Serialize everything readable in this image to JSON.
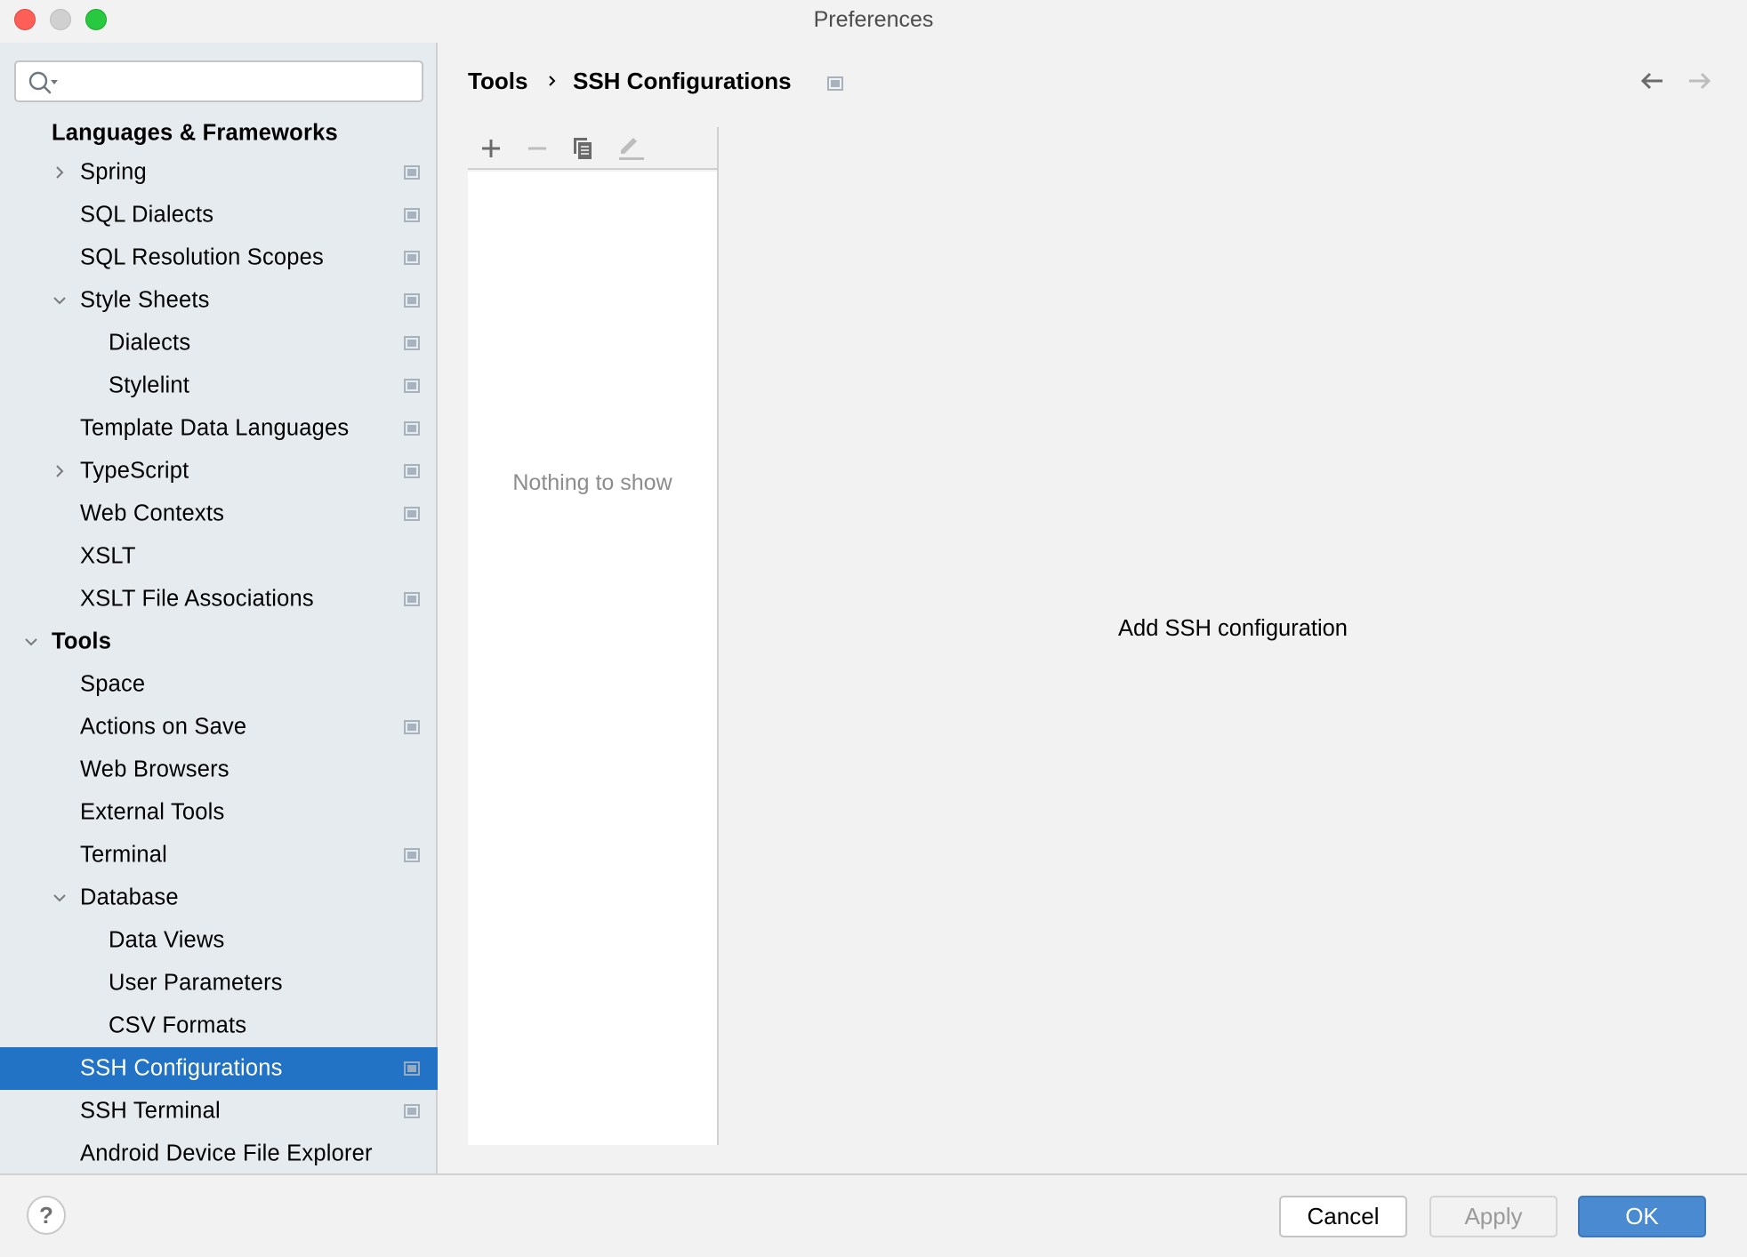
{
  "window": {
    "title": "Preferences"
  },
  "search": {
    "value": "",
    "placeholder": ""
  },
  "sidebar": {
    "items": [
      {
        "label": "Languages & Frameworks",
        "level": 0,
        "bold": true,
        "chevron": "none",
        "project_icon": false,
        "selected": false
      },
      {
        "label": "Spring",
        "level": 1,
        "bold": false,
        "chevron": "right",
        "project_icon": true,
        "selected": false
      },
      {
        "label": "SQL Dialects",
        "level": 1,
        "bold": false,
        "chevron": "none",
        "project_icon": true,
        "selected": false
      },
      {
        "label": "SQL Resolution Scopes",
        "level": 1,
        "bold": false,
        "chevron": "none",
        "project_icon": true,
        "selected": false
      },
      {
        "label": "Style Sheets",
        "level": 1,
        "bold": false,
        "chevron": "down",
        "project_icon": true,
        "selected": false
      },
      {
        "label": "Dialects",
        "level": 2,
        "bold": false,
        "chevron": "none",
        "project_icon": true,
        "selected": false
      },
      {
        "label": "Stylelint",
        "level": 2,
        "bold": false,
        "chevron": "none",
        "project_icon": true,
        "selected": false
      },
      {
        "label": "Template Data Languages",
        "level": 1,
        "bold": false,
        "chevron": "none",
        "project_icon": true,
        "selected": false
      },
      {
        "label": "TypeScript",
        "level": 1,
        "bold": false,
        "chevron": "right",
        "project_icon": true,
        "selected": false
      },
      {
        "label": "Web Contexts",
        "level": 1,
        "bold": false,
        "chevron": "none",
        "project_icon": true,
        "selected": false
      },
      {
        "label": "XSLT",
        "level": 1,
        "bold": false,
        "chevron": "none",
        "project_icon": false,
        "selected": false
      },
      {
        "label": "XSLT File Associations",
        "level": 1,
        "bold": false,
        "chevron": "none",
        "project_icon": true,
        "selected": false
      },
      {
        "label": "Tools",
        "level": 0,
        "bold": true,
        "chevron": "down",
        "project_icon": false,
        "selected": false
      },
      {
        "label": "Space",
        "level": 1,
        "bold": false,
        "chevron": "none",
        "project_icon": false,
        "selected": false
      },
      {
        "label": "Actions on Save",
        "level": 1,
        "bold": false,
        "chevron": "none",
        "project_icon": true,
        "selected": false
      },
      {
        "label": "Web Browsers",
        "level": 1,
        "bold": false,
        "chevron": "none",
        "project_icon": false,
        "selected": false
      },
      {
        "label": "External Tools",
        "level": 1,
        "bold": false,
        "chevron": "none",
        "project_icon": false,
        "selected": false
      },
      {
        "label": "Terminal",
        "level": 1,
        "bold": false,
        "chevron": "none",
        "project_icon": true,
        "selected": false
      },
      {
        "label": "Database",
        "level": 1,
        "bold": false,
        "chevron": "down",
        "project_icon": false,
        "selected": false
      },
      {
        "label": "Data Views",
        "level": 2,
        "bold": false,
        "chevron": "none",
        "project_icon": false,
        "selected": false
      },
      {
        "label": "User Parameters",
        "level": 2,
        "bold": false,
        "chevron": "none",
        "project_icon": false,
        "selected": false
      },
      {
        "label": "CSV Formats",
        "level": 2,
        "bold": false,
        "chevron": "none",
        "project_icon": false,
        "selected": false
      },
      {
        "label": "SSH Configurations",
        "level": 1,
        "bold": false,
        "chevron": "none",
        "project_icon": true,
        "selected": true
      },
      {
        "label": "SSH Terminal",
        "level": 1,
        "bold": false,
        "chevron": "none",
        "project_icon": true,
        "selected": false
      },
      {
        "label": "Android Device File Explorer",
        "level": 1,
        "bold": false,
        "chevron": "none",
        "project_icon": false,
        "selected": false
      }
    ]
  },
  "breadcrumb": {
    "parent": "Tools",
    "current": "SSH Configurations"
  },
  "nav": {
    "back_enabled": true,
    "forward_enabled": false
  },
  "list": {
    "toolbar": {
      "add": {
        "icon": "plus-icon",
        "enabled": true
      },
      "remove": {
        "icon": "minus-icon",
        "enabled": false
      },
      "copy": {
        "icon": "copy-icon",
        "enabled": true
      },
      "edit": {
        "icon": "pencil-icon",
        "enabled": false
      }
    },
    "empty_text": "Nothing to show"
  },
  "detail": {
    "hint": "Add SSH configuration"
  },
  "footer": {
    "help_label": "?",
    "cancel_label": "Cancel",
    "apply_label": "Apply",
    "ok_label": "OK"
  },
  "colors": {
    "selection": "#2272C6",
    "ok_button": "#4A8AD0",
    "sidebar_bg": "#E6EBF0"
  }
}
